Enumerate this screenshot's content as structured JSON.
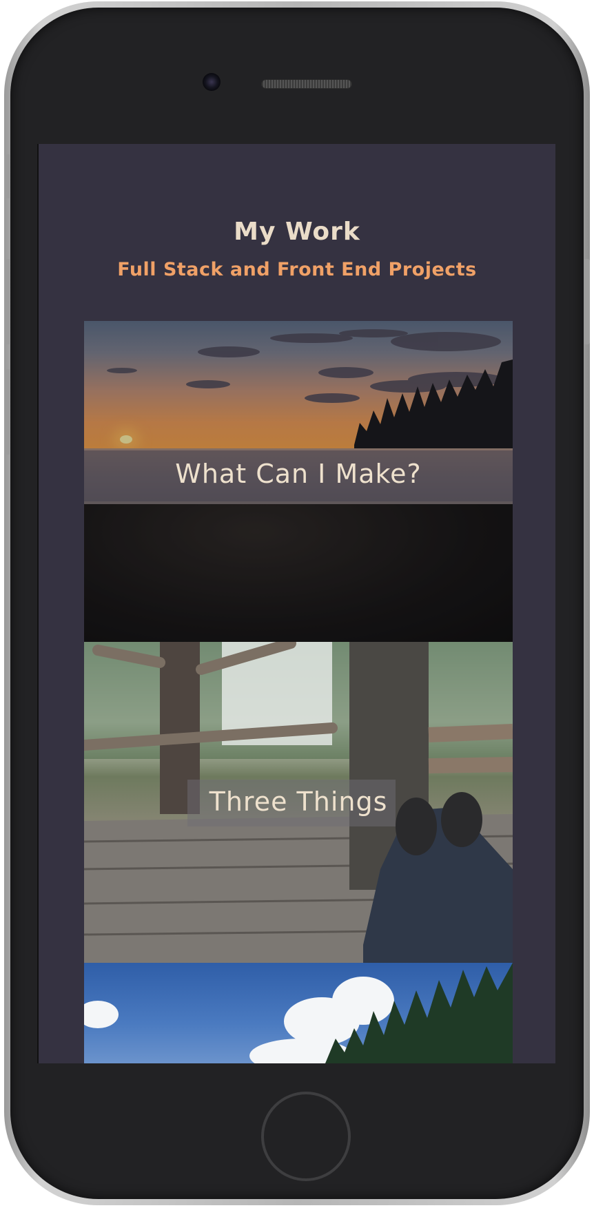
{
  "header": {
    "title": "My Work",
    "subtitle": "Full Stack and Front End Projects"
  },
  "projects": [
    {
      "caption": "What Can I Make?",
      "image": "sunset-shore-photo"
    },
    {
      "caption": "Three Things",
      "image": "treehouse-deck-photo"
    },
    {
      "caption": "",
      "image": "blue-sky-clouds-photo"
    }
  ],
  "colors": {
    "background": "#353241",
    "title": "#eadcc8",
    "subtitle": "#f0a167",
    "caption": "#eee1cd"
  }
}
